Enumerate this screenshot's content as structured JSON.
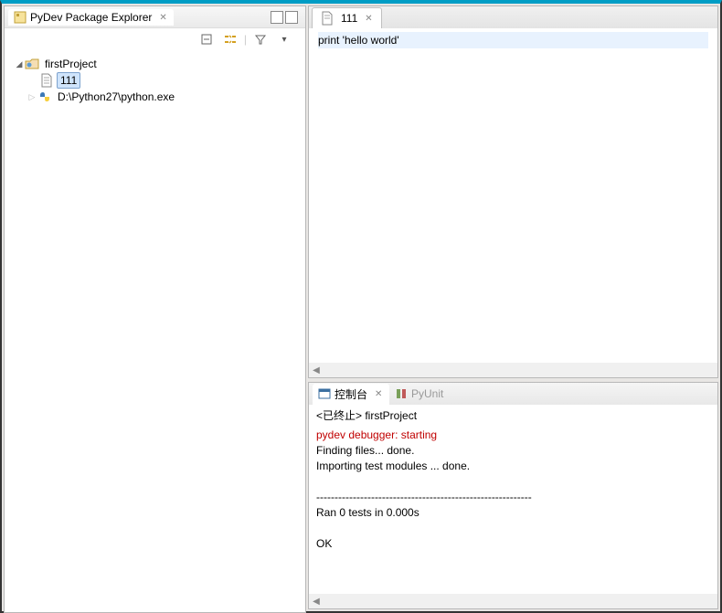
{
  "explorer": {
    "title": "PyDev Package Explorer",
    "project_name": "firstProject",
    "file_name": "111",
    "python_path": "D:\\Python27\\python.exe"
  },
  "editor": {
    "tab_name": "111",
    "code_line": "    print 'hello world'"
  },
  "console": {
    "tab_console": "控制台",
    "tab_pyunit": "PyUnit",
    "header": "<已终止> firstProject",
    "line1": "pydev debugger: starting",
    "line2": "Finding files... done.",
    "line3": "Importing test modules ... done.",
    "line4": "",
    "sep": "-----------------------------------------------------------",
    "line5": "Ran 0 tests in 0.000s",
    "line6": "",
    "line7": "OK"
  },
  "icons": {
    "close_x": "✕",
    "triangle_down": "▾",
    "triangle_right": "▸",
    "collapse": "⊟"
  }
}
